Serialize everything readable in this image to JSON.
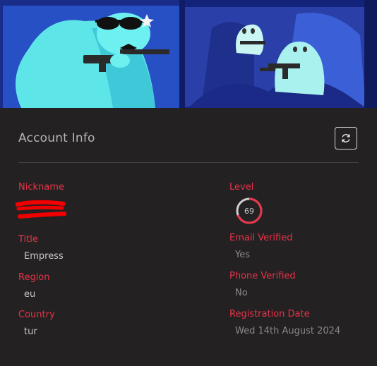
{
  "header": {
    "title": "Account Info",
    "refresh_icon": "refresh-icon"
  },
  "left_fields": {
    "nickname": {
      "label": "Nickname",
      "value": ""
    },
    "title": {
      "label": "Title",
      "value": "Empress"
    },
    "region": {
      "label": "Region",
      "value": "eu"
    },
    "country": {
      "label": "Country",
      "value": "tur"
    }
  },
  "right_fields": {
    "level": {
      "label": "Level",
      "value": "69",
      "progress": 0.69
    },
    "email_verified": {
      "label": "Email Verified",
      "value": "Yes"
    },
    "phone_verified": {
      "label": "Phone Verified",
      "value": "No"
    },
    "registration_date": {
      "label": "Registration Date",
      "value": "Wed 14th August 2024"
    }
  },
  "colors": {
    "accent": "#e8334a",
    "background": "#232121",
    "text": "#c9c7c7",
    "ring_fill": "#e8334a",
    "ring_track": "#cfcfcf"
  }
}
